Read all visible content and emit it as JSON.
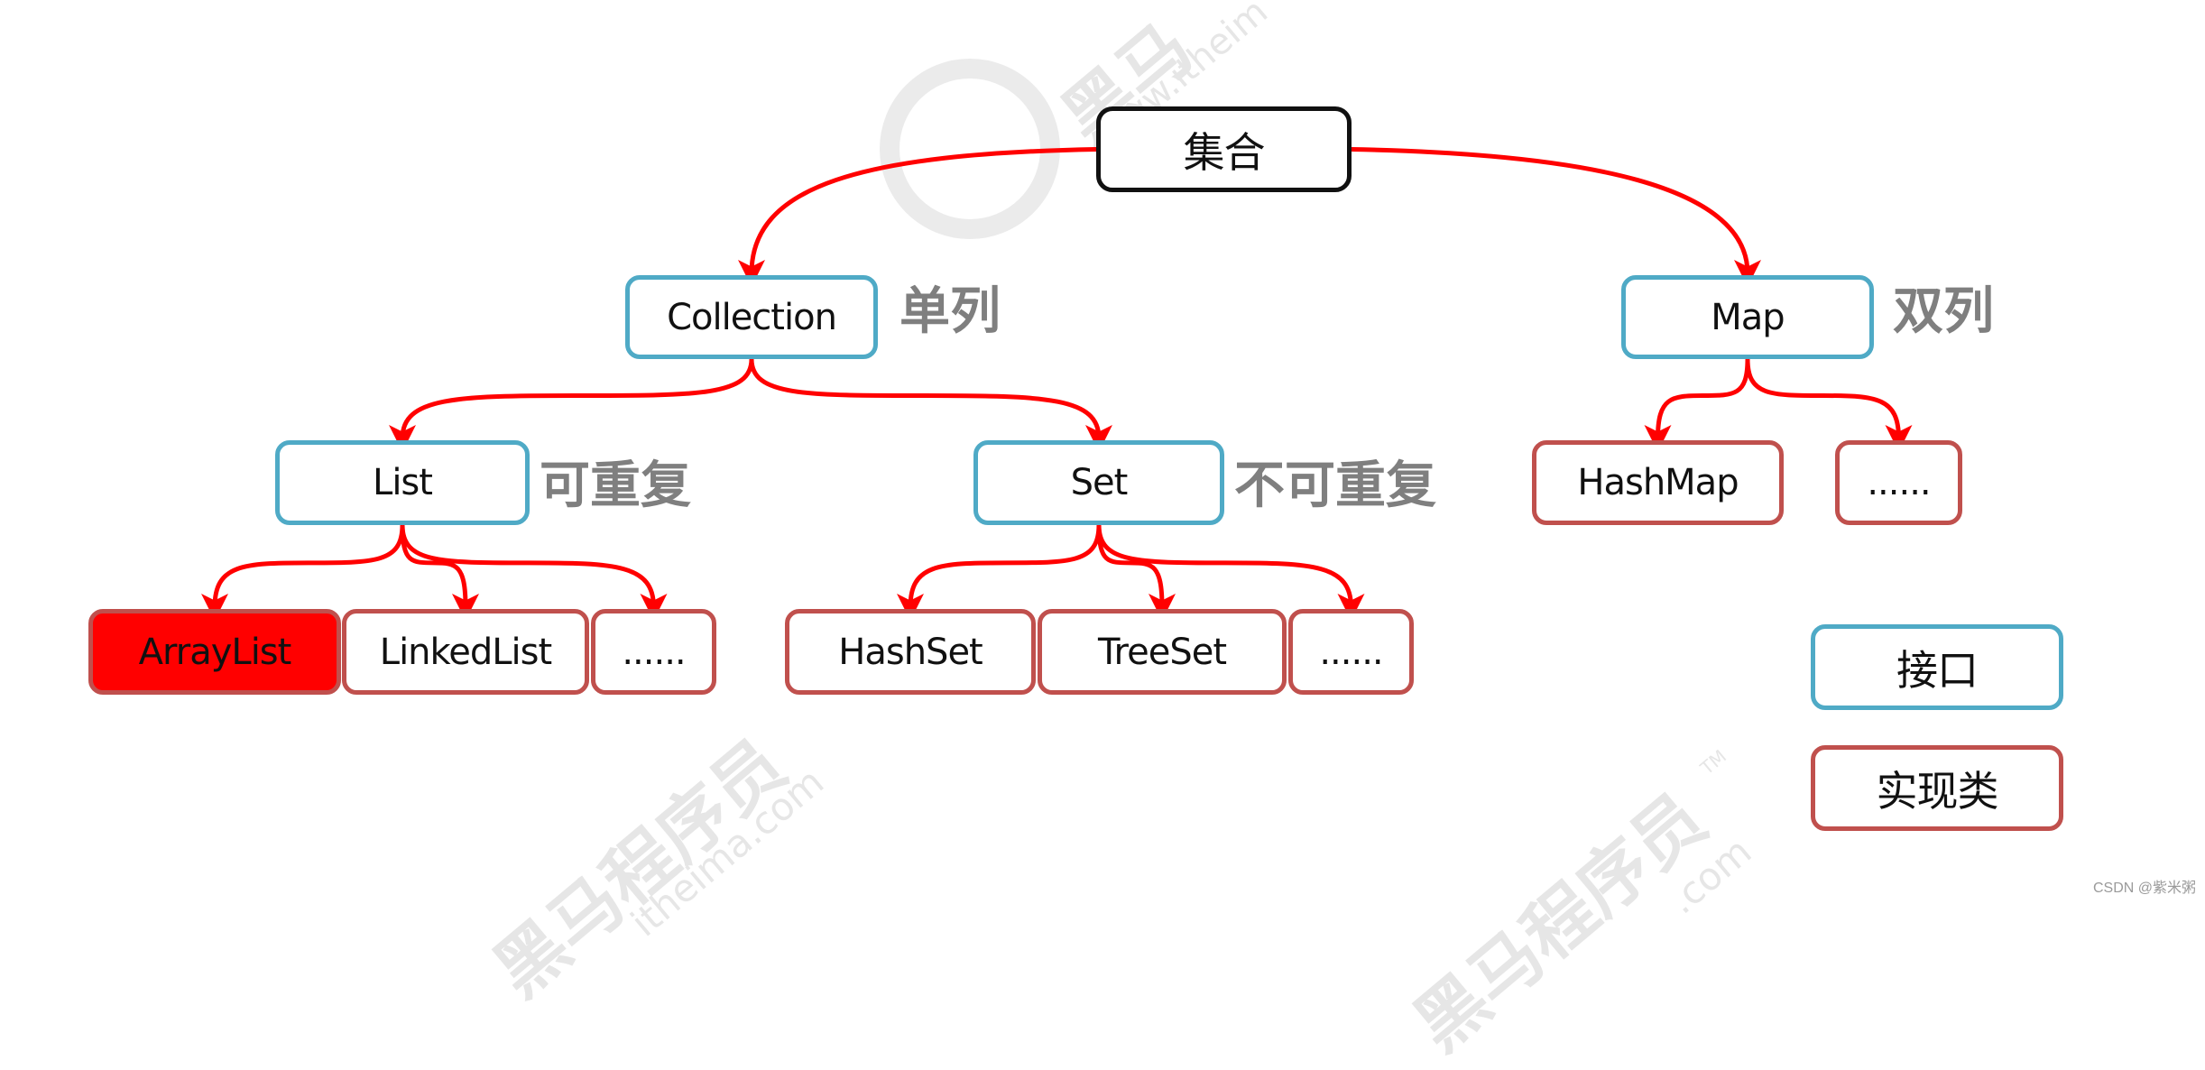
{
  "diagram": {
    "root": {
      "id": "collection-root",
      "label": "集合",
      "kind": "root"
    },
    "nodes": [
      {
        "id": "collection",
        "label": "Collection",
        "kind": "interface",
        "parent": "collection-root",
        "tag": "单列"
      },
      {
        "id": "map",
        "label": "Map",
        "kind": "interface",
        "parent": "collection-root",
        "tag": "双列"
      },
      {
        "id": "list",
        "label": "List",
        "kind": "interface",
        "parent": "collection",
        "tag": "可重复"
      },
      {
        "id": "set",
        "label": "Set",
        "kind": "interface",
        "parent": "collection",
        "tag": "不可重复"
      },
      {
        "id": "arraylist",
        "label": "ArrayList",
        "kind": "implementation",
        "parent": "list",
        "highlighted": true
      },
      {
        "id": "linkedlist",
        "label": "LinkedList",
        "kind": "implementation",
        "parent": "list"
      },
      {
        "id": "list-more",
        "label": "......",
        "kind": "implementation",
        "parent": "list"
      },
      {
        "id": "hashset",
        "label": "HashSet",
        "kind": "implementation",
        "parent": "set"
      },
      {
        "id": "treeset",
        "label": "TreeSet",
        "kind": "implementation",
        "parent": "set"
      },
      {
        "id": "set-more",
        "label": "......",
        "kind": "implementation",
        "parent": "set"
      },
      {
        "id": "hashmap",
        "label": "HashMap",
        "kind": "implementation",
        "parent": "map"
      },
      {
        "id": "map-more",
        "label": "......",
        "kind": "implementation",
        "parent": "map"
      }
    ],
    "legend": [
      {
        "label": "接口",
        "kind": "interface"
      },
      {
        "label": "实现类",
        "kind": "implementation"
      }
    ]
  },
  "colors": {
    "interface_border": "#4faac6",
    "implementation_border": "#c0504d",
    "root_border": "#111111",
    "arrow": "#ff0000",
    "highlight_fill": "#ff0000",
    "tag_text": "#7f7f7f"
  },
  "watermark": {
    "brand_cn": "黑马程序员",
    "brand_short": "黑马",
    "url_top": "www.itheim",
    "url_bottom": "itheima.com",
    "url_bottom_right": ".com",
    "trademark": "TM"
  },
  "credit": "CSDN @紫米粥"
}
